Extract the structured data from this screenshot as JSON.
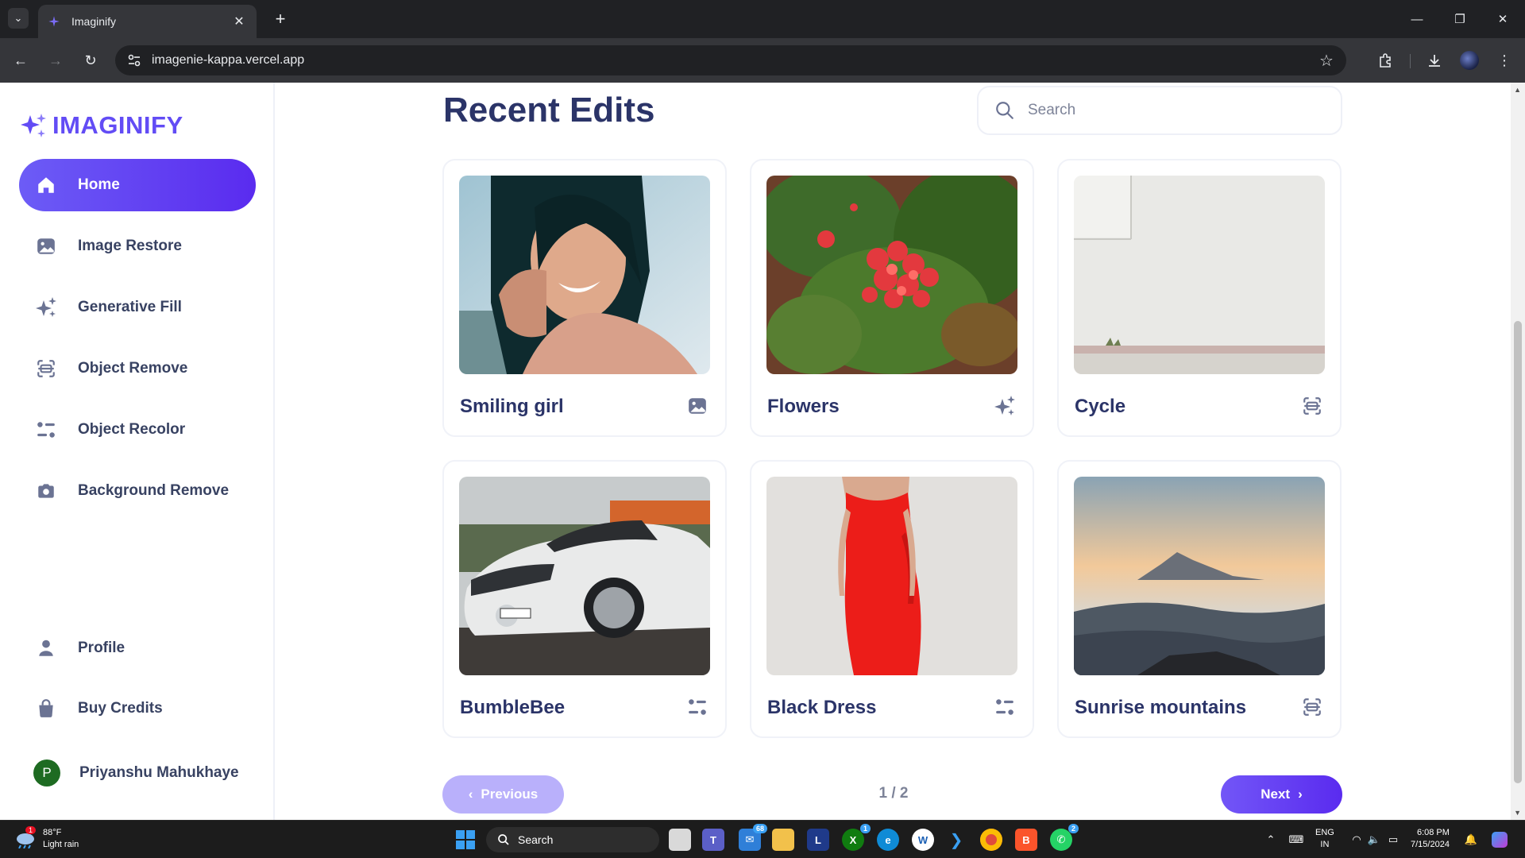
{
  "browser": {
    "tab_title": "Imaginify",
    "url": "imagenie-kappa.vercel.app"
  },
  "sidebar": {
    "logo_text": "IMAGINIFY",
    "items": [
      {
        "label": "Home",
        "icon": "home-icon",
        "active": true
      },
      {
        "label": "Image Restore",
        "icon": "image-icon"
      },
      {
        "label": "Generative Fill",
        "icon": "stars-icon"
      },
      {
        "label": "Object Remove",
        "icon": "scan-icon"
      },
      {
        "label": "Object Recolor",
        "icon": "filter-icon"
      },
      {
        "label": "Background Remove",
        "icon": "camera-icon"
      }
    ],
    "bottom_items": [
      {
        "label": "Profile",
        "icon": "user-icon"
      },
      {
        "label": "Buy Credits",
        "icon": "bag-icon"
      }
    ],
    "user": {
      "initial": "P",
      "name": "Priyanshu Mahukhaye"
    }
  },
  "main": {
    "title": "Recent Edits",
    "search_placeholder": "Search",
    "cards": [
      {
        "title": "Smiling girl",
        "icon": "image-icon"
      },
      {
        "title": "Flowers",
        "icon": "stars-icon"
      },
      {
        "title": "Cycle",
        "icon": "scan-icon"
      },
      {
        "title": "BumbleBee",
        "icon": "filter-icon"
      },
      {
        "title": "Black Dress",
        "icon": "filter-icon"
      },
      {
        "title": "Sunrise mountains",
        "icon": "scan-icon"
      }
    ],
    "pagination": {
      "prev": "Previous",
      "next": "Next",
      "info": "1 / 2"
    }
  },
  "taskbar": {
    "weather_temp": "88°F",
    "weather_desc": "Light rain",
    "weather_badge": "1",
    "search_label": "Search",
    "mail_badge": "68",
    "xbox_badge": "1",
    "whatsapp_badge": "2",
    "lang_1": "ENG",
    "lang_2": "IN",
    "time": "6:08 PM",
    "date": "7/15/2024"
  },
  "colors": {
    "accent": "#624cf5",
    "accent_dark": "#5a2bef",
    "text": "#384262",
    "title": "#2b3468",
    "muted": "#7d8398"
  }
}
